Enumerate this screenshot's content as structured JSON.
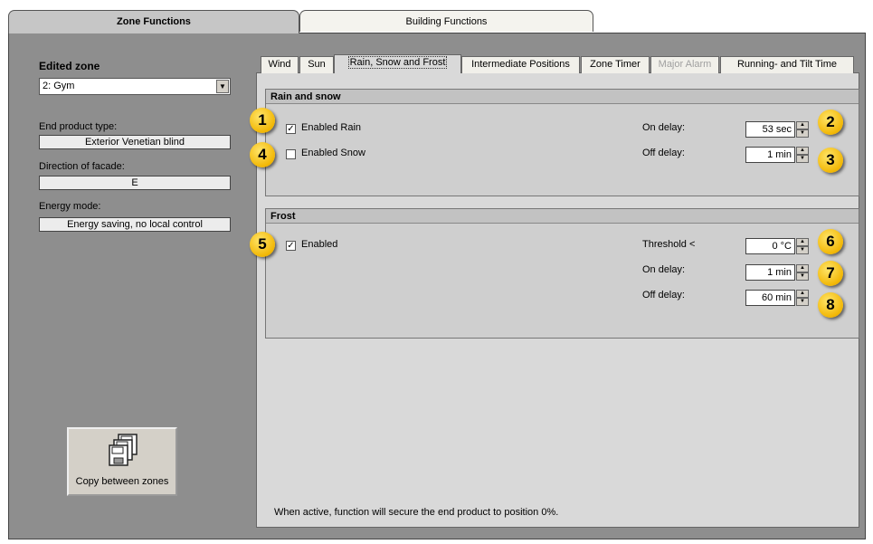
{
  "top_tabs": [
    {
      "label": "Zone Functions",
      "active": true
    },
    {
      "label": "Building Functions",
      "active": false
    }
  ],
  "sidebar": {
    "edited_zone_label": "Edited zone",
    "edited_zone_value": "2: Gym",
    "end_product_type_label": "End product type:",
    "end_product_type_value": "Exterior Venetian blind",
    "direction_label": "Direction of facade:",
    "direction_value": "E",
    "energy_mode_label": "Energy mode:",
    "energy_mode_value": "Energy saving, no local control",
    "copy_button_label": "Copy between zones",
    "copy_icon": "copy-disks-icon"
  },
  "inner_tabs": [
    {
      "label": "Wind",
      "active": false,
      "disabled": false
    },
    {
      "label": "Sun",
      "active": false,
      "disabled": false
    },
    {
      "label": "Rain, Snow and Frost",
      "active": true,
      "disabled": false
    },
    {
      "label": "Intermediate Positions",
      "active": false,
      "disabled": false
    },
    {
      "label": "Zone Timer",
      "active": false,
      "disabled": false
    },
    {
      "label": "Major Alarm",
      "active": false,
      "disabled": true
    },
    {
      "label": "Running- and Tilt Time",
      "active": false,
      "disabled": false
    }
  ],
  "rain_snow": {
    "title": "Rain and snow",
    "enabled_rain_label": "Enabled Rain",
    "enabled_rain_checked": true,
    "enabled_snow_label": "Enabled Snow",
    "enabled_snow_checked": false,
    "on_delay_label": "On delay:",
    "on_delay_value": "53 sec",
    "off_delay_label": "Off delay:",
    "off_delay_value": "1 min"
  },
  "frost": {
    "title": "Frost",
    "enabled_label": "Enabled",
    "enabled_checked": true,
    "threshold_label": "Threshold <",
    "threshold_value": "0 °C",
    "on_delay_label": "On delay:",
    "on_delay_value": "1 min",
    "off_delay_label": "Off delay:",
    "off_delay_value": "60 min"
  },
  "footer_note": "When active, function will secure the end product to position 0%.",
  "badges": [
    "1",
    "2",
    "3",
    "4",
    "5",
    "6",
    "7",
    "8"
  ],
  "colors": {
    "badge": "#f2b705",
    "frame": "#8e8e8e",
    "panel": "#d9d9d9"
  }
}
